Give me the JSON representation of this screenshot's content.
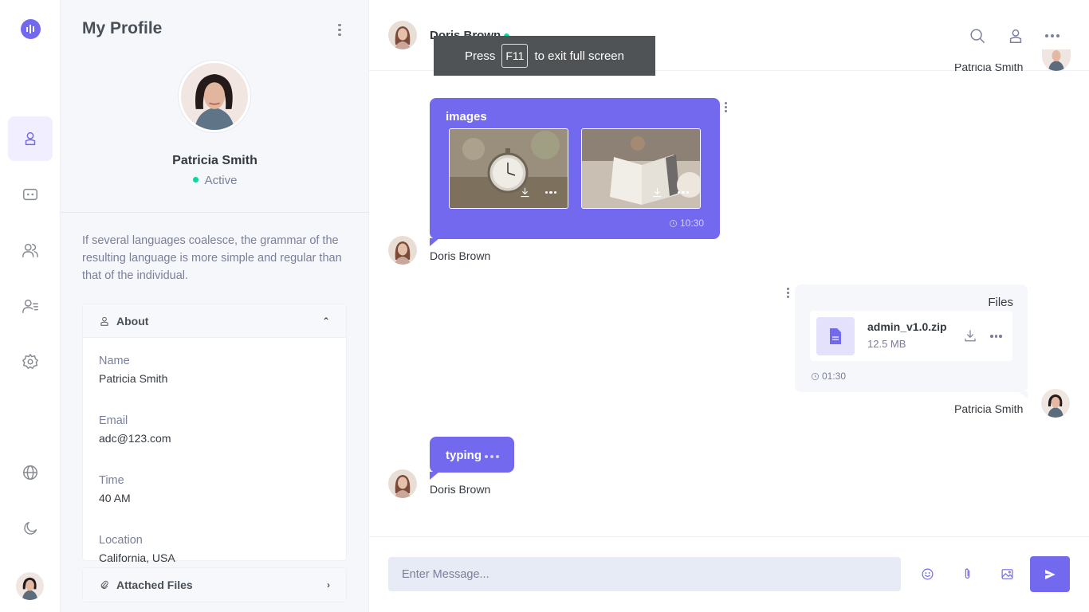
{
  "profile": {
    "title": "My Profile",
    "name": "Patricia Smith",
    "status": "Active",
    "bio": "If several languages coalesce, the grammar of the resulting language is more simple and regular than that of the individual.",
    "about_label": "About",
    "fields": [
      {
        "label": "Name",
        "value": "Patricia Smith"
      },
      {
        "label": "Email",
        "value": "adc@123.com"
      },
      {
        "label": "Time",
        "value": "40 AM"
      },
      {
        "label": "Location",
        "value": "California, USA"
      }
    ],
    "files_label": "Attached Files"
  },
  "chat": {
    "contact_name": "Doris Brown",
    "top_cut_name": "Patricia Smith",
    "fullscreen": {
      "press": "Press",
      "key": "F11",
      "rest": "to exit full screen"
    },
    "messages": {
      "images": {
        "title": "images",
        "time": "10:30",
        "sender": "Doris Brown"
      },
      "files": {
        "title": "Files",
        "file_name": "admin_v1.0.zip",
        "file_size": "12.5 MB",
        "time": "01:30",
        "sender": "Patricia Smith"
      },
      "typing": {
        "text": "typing",
        "sender": "Doris Brown"
      }
    },
    "input": {
      "placeholder": "Enter Message..."
    }
  },
  "colors": {
    "accent": "#7269ef",
    "online": "#06d6a0",
    "panel_bg": "#f5f7fb"
  }
}
